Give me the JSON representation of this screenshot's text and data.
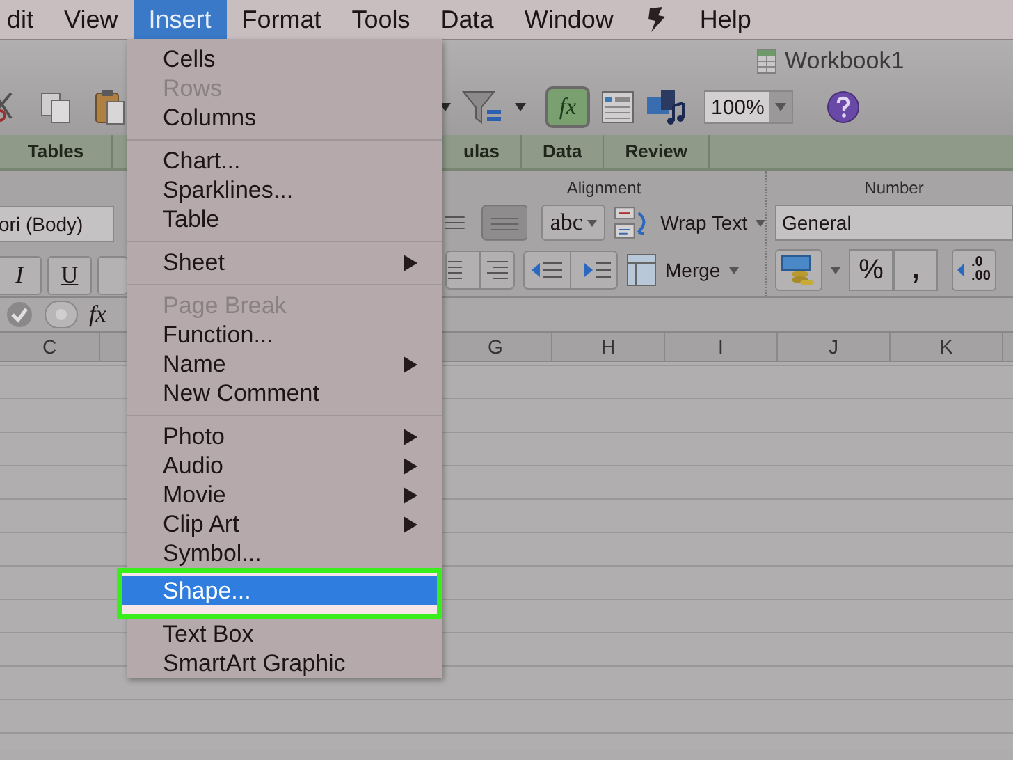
{
  "menubar": {
    "items": [
      {
        "label": "dit",
        "selected": false
      },
      {
        "label": "View",
        "selected": false
      },
      {
        "label": "Insert",
        "selected": true
      },
      {
        "label": "Format",
        "selected": false
      },
      {
        "label": "Tools",
        "selected": false
      },
      {
        "label": "Data",
        "selected": false
      },
      {
        "label": "Window",
        "selected": false
      }
    ],
    "help": "Help"
  },
  "toolbar": {
    "document_title": "Workbook1",
    "function_button": "fx",
    "zoom": "100%"
  },
  "ribbon_tabs": {
    "left": [
      "Tables"
    ],
    "right": [
      "ulas",
      "Data",
      "Review"
    ]
  },
  "ribbon": {
    "font": "ori (Body)",
    "style_buttons": [
      "I",
      "U"
    ],
    "alignment_title": "Alignment",
    "orientation": "abc",
    "wrap_text": "Wrap Text",
    "merge": "Merge",
    "number_title": "Number",
    "number_format": "General",
    "percent": "%",
    "comma": ",",
    "decimal_labels": [
      ".0",
      ".00"
    ]
  },
  "formula_bar": {
    "fx": "fx"
  },
  "columns": {
    "left": [
      "C"
    ],
    "right": [
      "G",
      "H",
      "I",
      "J",
      "K"
    ]
  },
  "menu": {
    "items": [
      {
        "kind": "item",
        "label": "Cells",
        "disabled": false,
        "submenu": false,
        "selected": false
      },
      {
        "kind": "item",
        "label": "Rows",
        "disabled": true,
        "submenu": false,
        "selected": false
      },
      {
        "kind": "item",
        "label": "Columns",
        "disabled": false,
        "submenu": false,
        "selected": false
      },
      {
        "kind": "separator"
      },
      {
        "kind": "item",
        "label": "Chart...",
        "disabled": false,
        "submenu": false,
        "selected": false
      },
      {
        "kind": "item",
        "label": "Sparklines...",
        "disabled": false,
        "submenu": false,
        "selected": false
      },
      {
        "kind": "item",
        "label": "Table",
        "disabled": false,
        "submenu": false,
        "selected": false
      },
      {
        "kind": "separator"
      },
      {
        "kind": "item",
        "label": "Sheet",
        "disabled": false,
        "submenu": true,
        "selected": false
      },
      {
        "kind": "separator"
      },
      {
        "kind": "item",
        "label": "Page Break",
        "disabled": true,
        "submenu": false,
        "selected": false
      },
      {
        "kind": "item",
        "label": "Function...",
        "disabled": false,
        "submenu": false,
        "selected": false
      },
      {
        "kind": "item",
        "label": "Name",
        "disabled": false,
        "submenu": true,
        "selected": false
      },
      {
        "kind": "item",
        "label": "New Comment",
        "disabled": false,
        "submenu": false,
        "selected": false
      },
      {
        "kind": "separator"
      },
      {
        "kind": "item",
        "label": "Photo",
        "disabled": false,
        "submenu": true,
        "selected": false
      },
      {
        "kind": "item",
        "label": "Audio",
        "disabled": false,
        "submenu": true,
        "selected": false
      },
      {
        "kind": "item",
        "label": "Movie",
        "disabled": false,
        "submenu": true,
        "selected": false
      },
      {
        "kind": "item",
        "label": "Clip Art",
        "disabled": false,
        "submenu": true,
        "selected": false
      },
      {
        "kind": "item",
        "label": "Symbol...",
        "disabled": false,
        "submenu": false,
        "selected": false
      },
      {
        "kind": "item",
        "label": "Shape...",
        "disabled": false,
        "submenu": false,
        "selected": true
      },
      {
        "kind": "item",
        "label": "Text Box",
        "disabled": false,
        "submenu": false,
        "selected": false
      },
      {
        "kind": "item",
        "label": "SmartArt Graphic",
        "disabled": false,
        "submenu": false,
        "selected": false
      }
    ]
  }
}
